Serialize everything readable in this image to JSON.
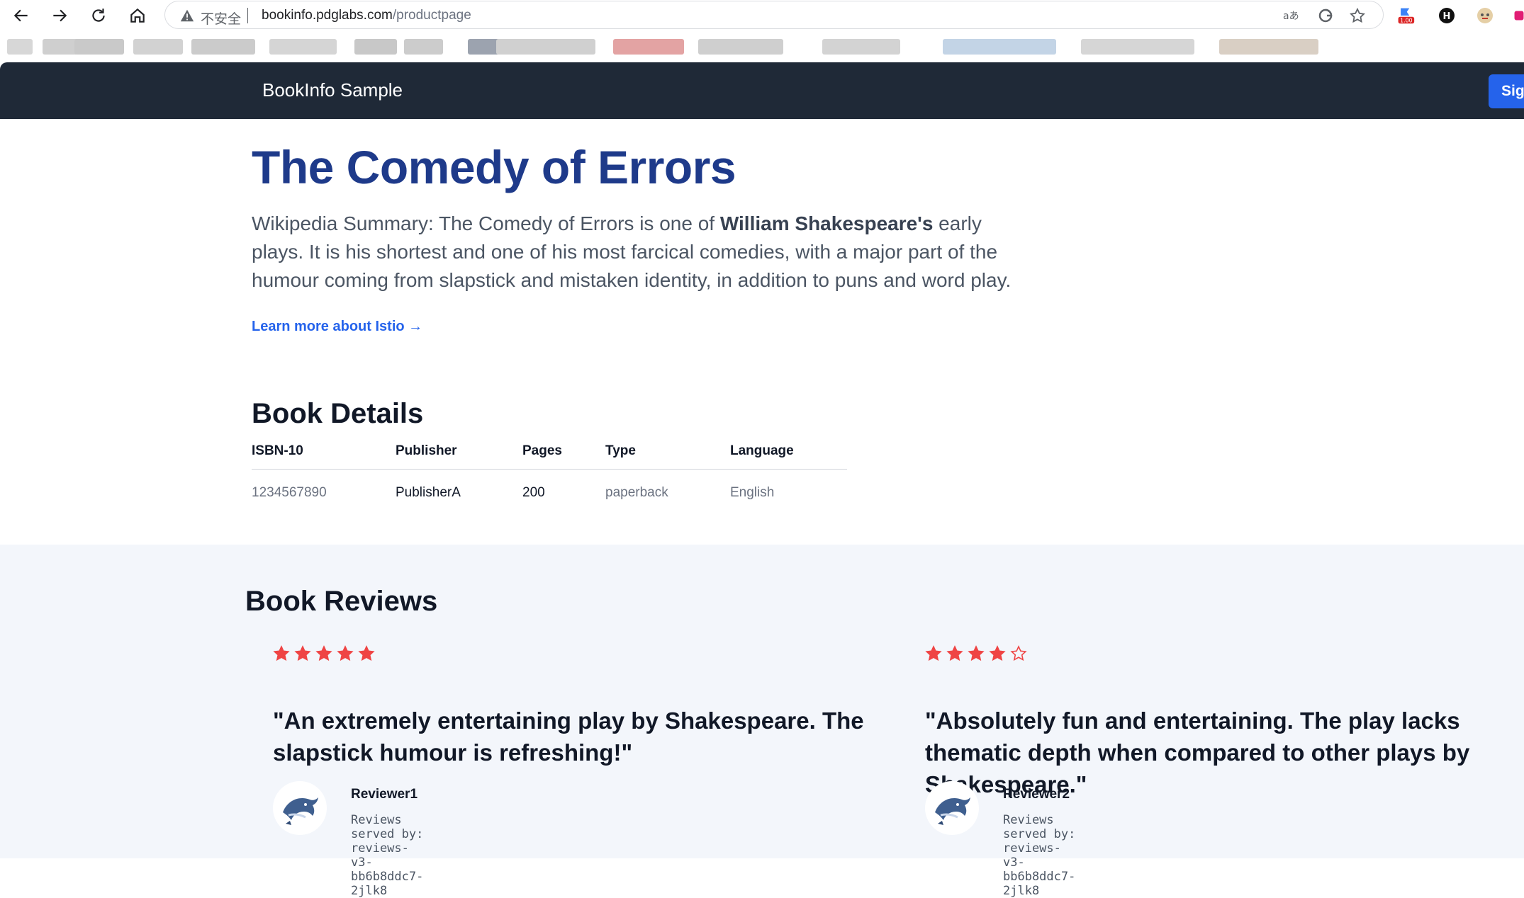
{
  "browser": {
    "security_label": "不安全",
    "url_host": "bookinfo.pdglabs.com",
    "url_path": "/productpage",
    "extension_badge": "1.00",
    "extension_letter": "H"
  },
  "header": {
    "brand": "BookInfo Sample",
    "signin_label": "Sign in"
  },
  "product": {
    "title": "The Comedy of Errors",
    "summary_pre": "Wikipedia Summary: The Comedy of Errors is one of ",
    "summary_bold": "William Shakespeare's",
    "summary_post": " early plays. It is his shortest and one of his most farcical comedies, with a major part of the humour coming from slapstick and mistaken identity, in addition to puns and word play.",
    "learn_more": "Learn more about Istio →"
  },
  "details": {
    "title": "Book Details",
    "headers": [
      "ISBN-10",
      "Publisher",
      "Pages",
      "Type",
      "Language"
    ],
    "row": [
      "1234567890",
      "PublisherA",
      "200",
      "paperback",
      "English"
    ]
  },
  "reviews": {
    "title": "Book Reviews",
    "star_color": "#ef4444",
    "items": [
      {
        "rating": 5,
        "max": 5,
        "text": "\"An extremely entertaining play by Shakespeare. The slapstick humour is refreshing!\"",
        "reviewer": "Reviewer1",
        "served_by": "Reviews served by: reviews-v3-bb6b8ddc7-2jlk8"
      },
      {
        "rating": 4,
        "max": 5,
        "text": "\"Absolutely fun and entertaining. The play lacks thematic depth when compared to other plays by Shakespeare.\"",
        "reviewer": "Reviewer2",
        "served_by": "Reviews served by: reviews-v3-bb6b8ddc7-2jlk8"
      }
    ]
  }
}
